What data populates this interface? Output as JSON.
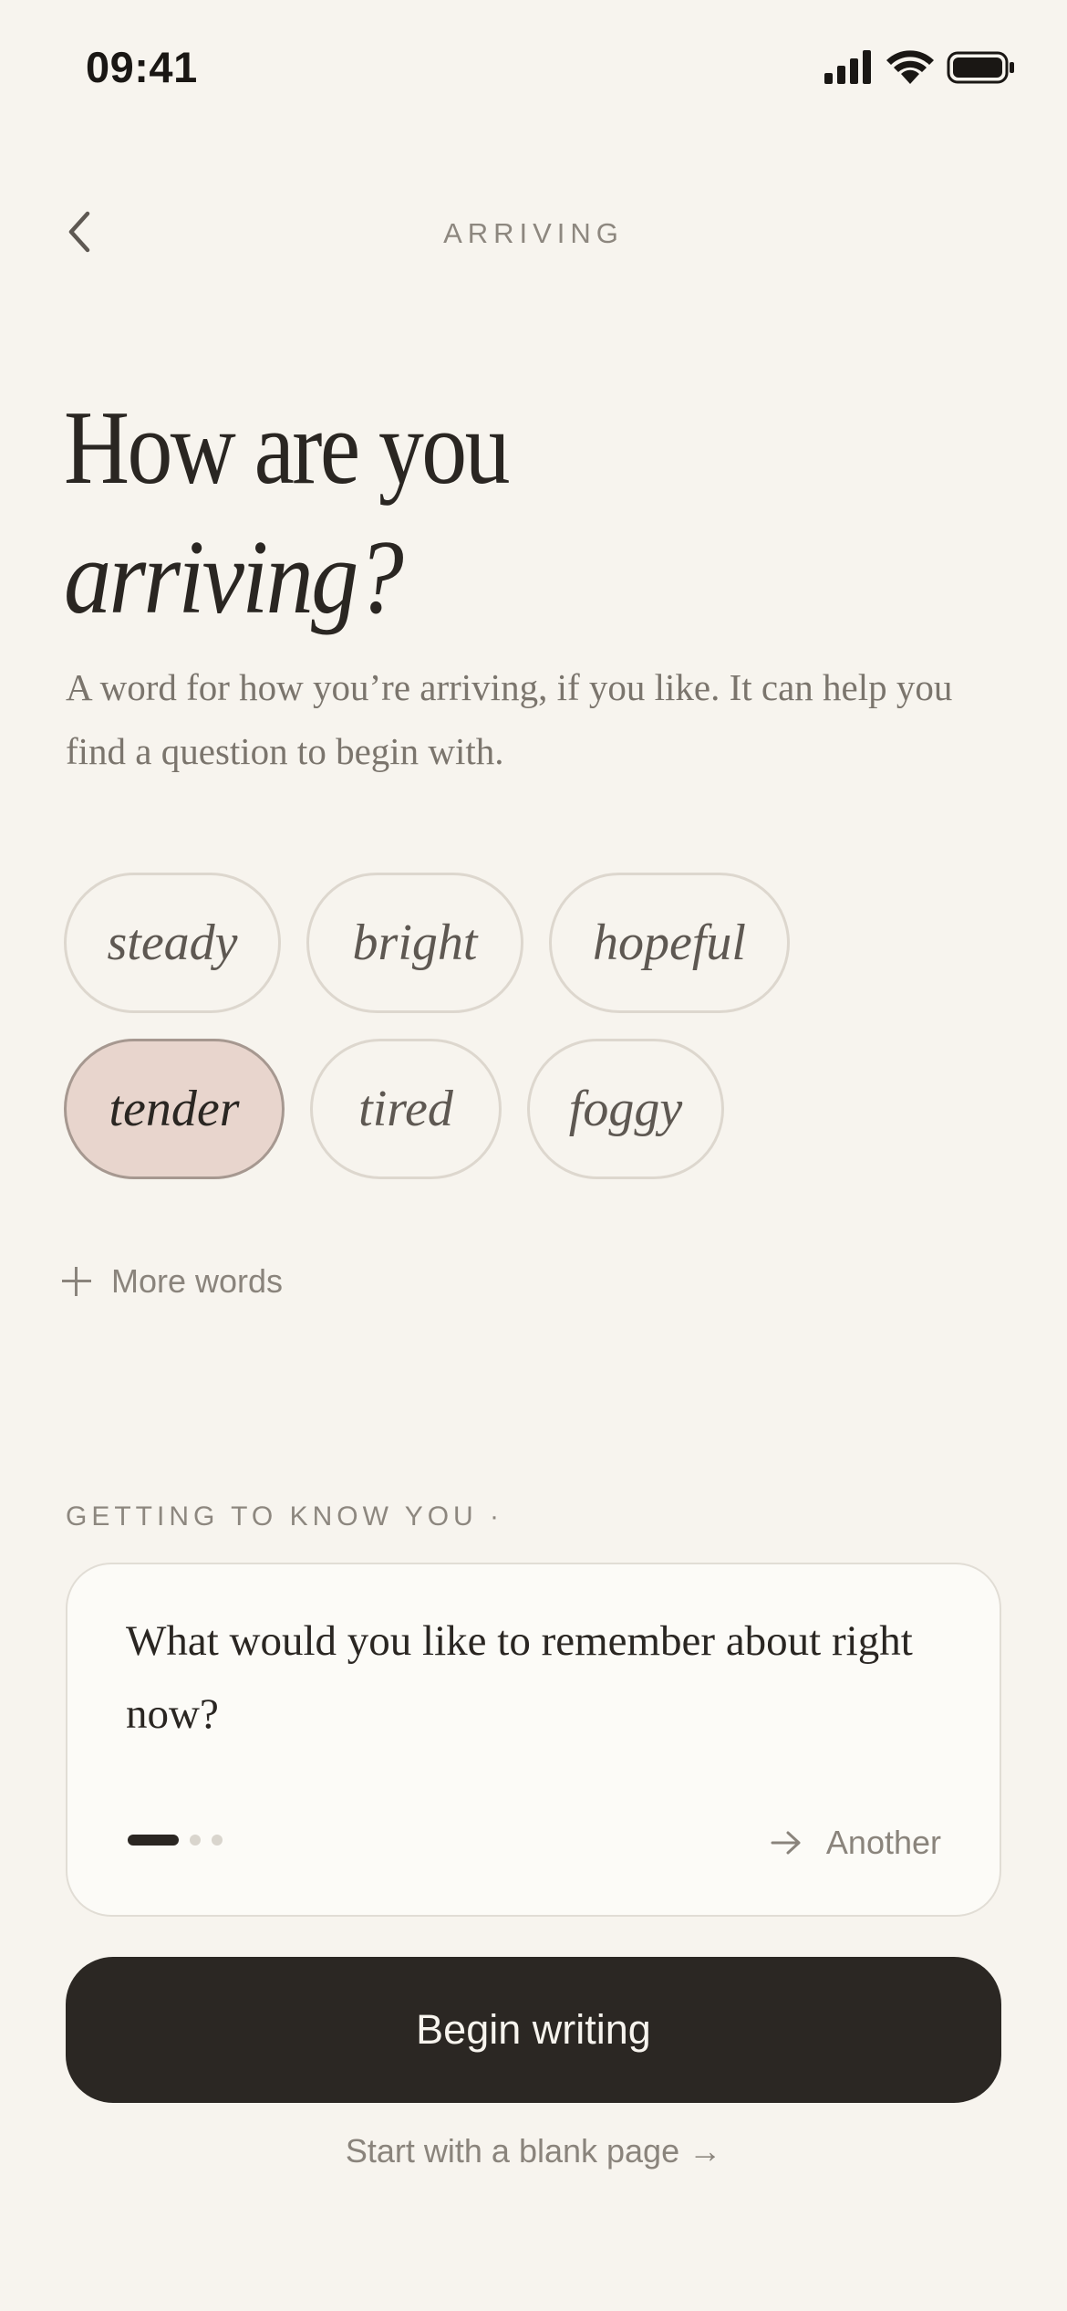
{
  "status_bar": {
    "time": "09:41"
  },
  "nav": {
    "title": "ARRIVING"
  },
  "heading": {
    "line1": "How are you",
    "line2": "arriving?"
  },
  "subtitle": "A word for how you’re arriving, if you like. It can help you find a question to begin with.",
  "moods": {
    "row1": [
      {
        "label": "steady",
        "selected": false
      },
      {
        "label": "bright",
        "selected": false
      },
      {
        "label": "hopeful",
        "selected": false
      }
    ],
    "row2": [
      {
        "label": "tender",
        "selected": true
      },
      {
        "label": "tired",
        "selected": false
      },
      {
        "label": "foggy",
        "selected": false
      }
    ]
  },
  "more_words_label": "More words",
  "section_label": "GETTING TO KNOW YOU ·",
  "prompt_card": {
    "question": "What would you like to remember about right now?",
    "another_label": "Another",
    "page_count": 3,
    "current_page": 1
  },
  "begin_button_label": "Begin writing",
  "blank_page_link": "Start with a blank page →",
  "colors": {
    "background": "#f7f4ee",
    "selected_chip": "#e8d5cd",
    "primary_button": "#2b2723"
  }
}
